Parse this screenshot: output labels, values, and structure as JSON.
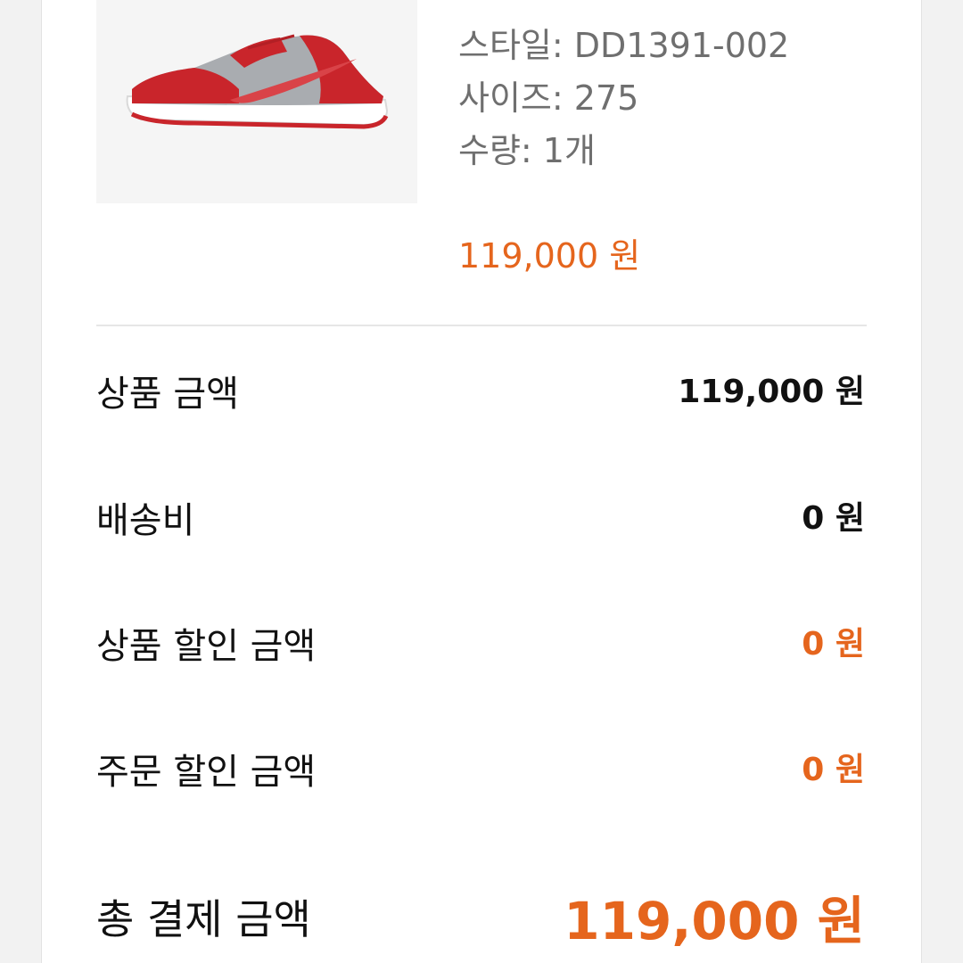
{
  "product": {
    "image_alt": "red-and-grey-low-top-sneaker",
    "style": "스타일: DD1391-002",
    "size": "사이즈: 275",
    "quantity": "수량: 1개",
    "price": "119,000 원"
  },
  "summary": {
    "rows": [
      {
        "label": "상품 금액",
        "value": "119,000 원"
      },
      {
        "label": "배송비",
        "value": "0 원"
      },
      {
        "label": "상품 할인 금액",
        "value": "0 원"
      },
      {
        "label": "주문 할인 금액",
        "value": "0 원"
      }
    ],
    "total_label": "총 결제 금액",
    "total_value": "119,000 원"
  },
  "colors": {
    "accent": "#e5651d",
    "text": "#111111",
    "muted": "#6f6f6f"
  }
}
